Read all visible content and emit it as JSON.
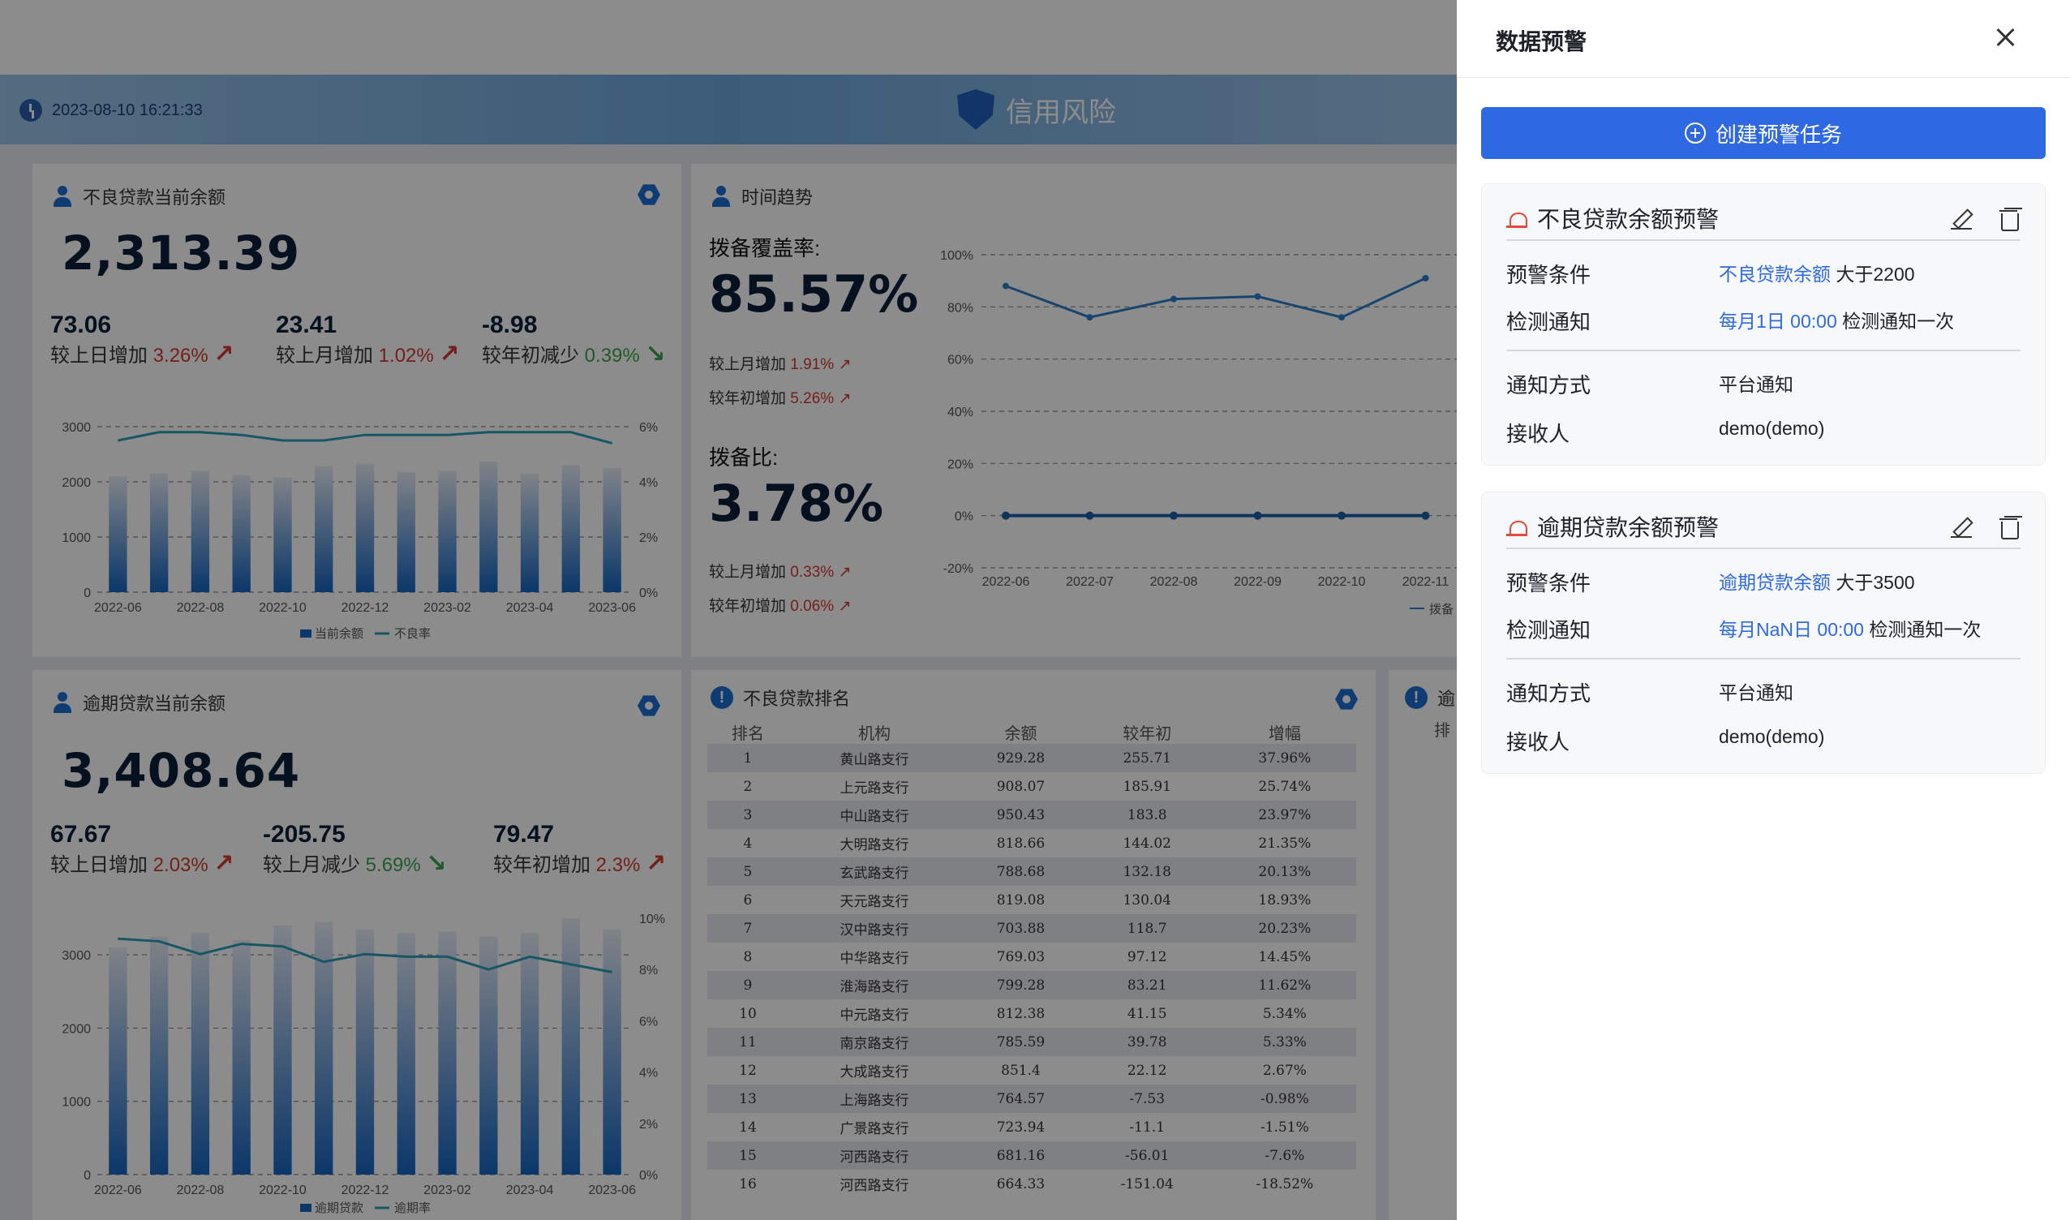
{
  "header": {
    "time": "2023-08-10 16:21:33",
    "title": "信用风险"
  },
  "npl_card": {
    "title": "不良贷款当前余额",
    "value": "2,313.39",
    "stats": [
      {
        "value": "73.06",
        "label": "较上日增加",
        "pct": "3.26%",
        "dir": "up"
      },
      {
        "value": "23.41",
        "label": "较上月增加",
        "pct": "1.02%",
        "dir": "up"
      },
      {
        "value": "-8.98",
        "label": "较年初减少",
        "pct": "0.39%",
        "dir": "down"
      }
    ],
    "legend": [
      "当前余额",
      "不良率"
    ]
  },
  "trend_card": {
    "title": "时间趋势",
    "coverage_label": "拨备覆盖率:",
    "coverage_value": "85.57%",
    "coverage_month": "较上月增加",
    "coverage_month_pct": "1.91%",
    "coverage_year": "较年初增加",
    "coverage_year_pct": "5.26%",
    "ratio_label": "拨备比:",
    "ratio_value": "3.78%",
    "ratio_month": "较上月增加",
    "ratio_month_pct": "0.33%",
    "ratio_year": "较年初增加",
    "ratio_year_pct": "0.06%",
    "legend": "拨备"
  },
  "overdue_card": {
    "title": "逾期贷款当前余额",
    "value": "3,408.64",
    "stats": [
      {
        "value": "67.67",
        "label": "较上日增加",
        "pct": "2.03%",
        "dir": "up"
      },
      {
        "value": "-205.75",
        "label": "较上月减少",
        "pct": "5.69%",
        "dir": "down"
      },
      {
        "value": "79.47",
        "label": "较年初增加",
        "pct": "2.3%",
        "dir": "up"
      }
    ],
    "legend": [
      "逾期贷款",
      "逾期率"
    ]
  },
  "rank_card": {
    "title": "不良贷款排名",
    "headers": [
      "排名",
      "机构",
      "余额",
      "较年初",
      "增幅"
    ],
    "rows": [
      [
        "1",
        "黄山路支行",
        "929.28",
        "255.71",
        "37.96%"
      ],
      [
        "2",
        "上元路支行",
        "908.07",
        "185.91",
        "25.74%"
      ],
      [
        "3",
        "中山路支行",
        "950.43",
        "183.8",
        "23.97%"
      ],
      [
        "4",
        "大明路支行",
        "818.66",
        "144.02",
        "21.35%"
      ],
      [
        "5",
        "玄武路支行",
        "788.68",
        "132.18",
        "20.13%"
      ],
      [
        "6",
        "天元路支行",
        "819.08",
        "130.04",
        "18.93%"
      ],
      [
        "7",
        "汉中路支行",
        "703.88",
        "118.7",
        "20.23%"
      ],
      [
        "8",
        "中华路支行",
        "769.03",
        "97.12",
        "14.45%"
      ],
      [
        "9",
        "淮海路支行",
        "799.28",
        "83.21",
        "11.62%"
      ],
      [
        "10",
        "中元路支行",
        "812.38",
        "41.15",
        "5.34%"
      ],
      [
        "11",
        "南京路支行",
        "785.59",
        "39.78",
        "5.33%"
      ],
      [
        "12",
        "大成路支行",
        "851.4",
        "22.12",
        "2.67%"
      ],
      [
        "13",
        "上海路支行",
        "764.57",
        "-7.53",
        "-0.98%"
      ],
      [
        "14",
        "广景路支行",
        "723.94",
        "-11.1",
        "-1.51%"
      ],
      [
        "15",
        "河西路支行",
        "681.16",
        "-56.01",
        "-7.6%"
      ],
      [
        "16",
        "河西路支行",
        "664.33",
        "-151.04",
        "-18.52%"
      ]
    ]
  },
  "side_card": {
    "title_partial": "逾",
    "headers_partial": "排"
  },
  "chart_data": [
    {
      "type": "bar",
      "title": "不良贷款当前余额",
      "categories": [
        "2022-06",
        "2022-07",
        "2022-08",
        "2022-09",
        "2022-10",
        "2022-11",
        "2022-12",
        "2023-01",
        "2023-02",
        "2023-03",
        "2023-04",
        "2023-05",
        "2023-06"
      ],
      "x_tick_labels": [
        "2022-06",
        "2022-08",
        "2022-10",
        "2022-12",
        "2023-02",
        "2023-04",
        "2023-06"
      ],
      "series": [
        {
          "name": "当前余额",
          "values": [
            2100,
            2150,
            2200,
            2120,
            2080,
            2280,
            2330,
            2180,
            2200,
            2370,
            2150,
            2300,
            2250
          ]
        },
        {
          "name": "不良率",
          "type": "line",
          "values": [
            5.5,
            5.8,
            5.8,
            5.7,
            5.5,
            5.5,
            5.7,
            5.7,
            5.7,
            5.8,
            5.8,
            5.8,
            5.4
          ]
        }
      ],
      "ylim": [
        0,
        3000
      ],
      "y_ticks": [
        "0",
        "1000",
        "2000",
        "3000"
      ],
      "y2lim": [
        0,
        6
      ],
      "y2_ticks": [
        "0%",
        "2%",
        "4%",
        "6%"
      ]
    },
    {
      "type": "line",
      "title": "时间趋势",
      "categories": [
        "2022-06",
        "2022-07",
        "2022-08",
        "2022-09",
        "2022-10",
        "2022-11"
      ],
      "series": [
        {
          "name": "拨备覆盖率",
          "values": [
            88,
            76,
            83,
            84,
            76,
            91
          ]
        },
        {
          "name": "拨备",
          "values": [
            0,
            0,
            0,
            0,
            0,
            0
          ]
        }
      ],
      "ylim": [
        -20,
        100
      ],
      "y_ticks": [
        "100%",
        "80%",
        "60%",
        "40%",
        "20%",
        "0%",
        "-20%"
      ]
    },
    {
      "type": "bar",
      "title": "逾期贷款当前余额",
      "categories": [
        "2022-06",
        "2022-07",
        "2022-08",
        "2022-09",
        "2022-10",
        "2022-11",
        "2022-12",
        "2023-01",
        "2023-02",
        "2023-03",
        "2023-04",
        "2023-05",
        "2023-06"
      ],
      "x_tick_labels": [
        "2022-06",
        "2022-08",
        "2022-10",
        "2022-12",
        "2023-02",
        "2023-04",
        "2023-06"
      ],
      "series": [
        {
          "name": "逾期贷款",
          "values": [
            3100,
            3250,
            3300,
            3200,
            3400,
            3450,
            3350,
            3300,
            3320,
            3250,
            3300,
            3500,
            3350
          ]
        },
        {
          "name": "逾期率",
          "type": "line",
          "values": [
            9.2,
            9.1,
            8.6,
            9.0,
            8.9,
            8.3,
            8.6,
            8.5,
            8.5,
            8.0,
            8.5,
            8.2,
            7.9
          ]
        }
      ],
      "ylim": [
        0,
        3500
      ],
      "y_ticks": [
        "0",
        "1000",
        "2000",
        "3000"
      ],
      "y2lim": [
        0,
        10
      ],
      "y2_ticks": [
        "0%",
        "2%",
        "4%",
        "6%",
        "8%",
        "10%"
      ]
    }
  ],
  "drawer": {
    "title": "数据预警",
    "create_button": "创建预警任务",
    "alerts": [
      {
        "name": "不良贷款余额预警",
        "cond_label": "预警条件",
        "cond_field": "不良贷款余额",
        "cond_rule": " 大于2200",
        "notify_label": "检测通知",
        "notify_time": "每月1日 00:00",
        "notify_rule": " 检测通知一次",
        "method_label": "通知方式",
        "method": "平台通知",
        "receiver_label": "接收人",
        "receiver": "demo(demo)"
      },
      {
        "name": "逾期贷款余额预警",
        "cond_label": "预警条件",
        "cond_field": "逾期贷款余额",
        "cond_rule": " 大于3500",
        "notify_label": "检测通知",
        "notify_time": "每月NaN日 00:00",
        "notify_rule": " 检测通知一次",
        "method_label": "通知方式",
        "method": "平台通知",
        "receiver_label": "接收人",
        "receiver": "demo(demo)"
      }
    ]
  }
}
